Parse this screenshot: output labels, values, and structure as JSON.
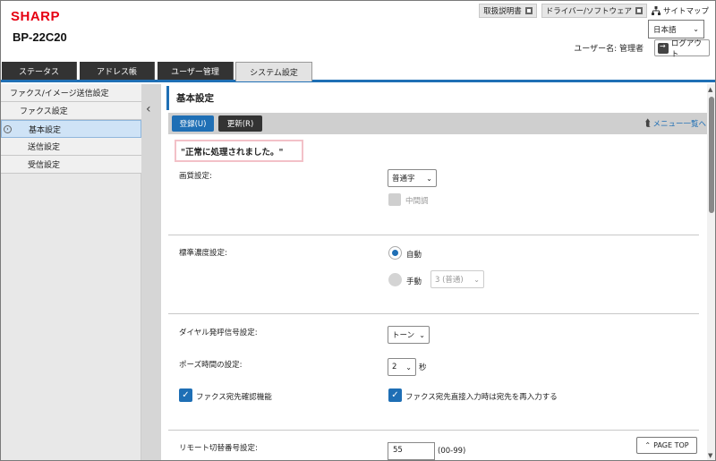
{
  "brand": {
    "logo": "SHARP",
    "model": "BP-22C20"
  },
  "toplinks": {
    "manual": "取扱説明書",
    "driver": "ドライバー/ソフトウェア",
    "sitemap": "サイトマップ"
  },
  "language": {
    "selected": "日本語"
  },
  "user": {
    "label": "ユーザー名: 管理者",
    "logout": "ログアウト"
  },
  "tabs": [
    {
      "label": "ステータス"
    },
    {
      "label": "アドレス帳"
    },
    {
      "label": "ユーザー管理"
    },
    {
      "label": "システム設定"
    }
  ],
  "sidebar": {
    "items": [
      {
        "label": "ファクス/イメージ送信設定"
      },
      {
        "label": "ファクス設定"
      },
      {
        "label": "基本設定"
      },
      {
        "label": "送信設定"
      },
      {
        "label": "受信設定"
      }
    ]
  },
  "main": {
    "title": "基本設定",
    "save_label": "登録(U)",
    "update_label": "更新(R)",
    "menu_back": "メニュー一覧へ",
    "notice": "\"正常に処理されました。\""
  },
  "settings": {
    "quality_label": "画質設定:",
    "quality_value": "普通字",
    "halftone_label": "中間調",
    "density_label": "標準濃度設定:",
    "auto_label": "自動",
    "manual_label": "手動",
    "manual_value": "3 (普通)",
    "dial_label": "ダイヤル発呼信号設定:",
    "dial_value": "トーン",
    "pause_label": "ポーズ時間の設定:",
    "pause_value": "2",
    "pause_unit": "秒",
    "confirm_label": "ファクス宛先確認機能",
    "reenter_label": "ファクス宛先直接入力時は宛先を再入力する",
    "remote_label": "リモート切替番号設定:",
    "remote_value": "55",
    "remote_range": "(00-99)"
  },
  "pagetop": "PAGE TOP",
  "colors": {
    "accent": "#1f6fb5",
    "brand": "#e60012"
  }
}
